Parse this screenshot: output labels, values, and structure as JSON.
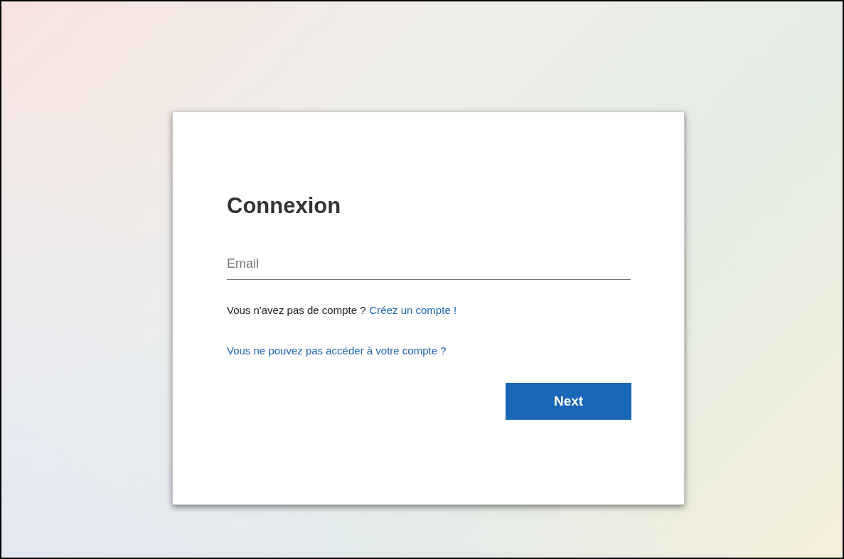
{
  "login": {
    "title": "Connexion",
    "email": {
      "placeholder": "Email"
    },
    "signup": {
      "text": "Vous n'avez pas de compte ?",
      "link": "Créez un compte !"
    },
    "recover_link": "Vous ne pouvez pas accéder à votre compte ?",
    "next_button": "Next"
  }
}
